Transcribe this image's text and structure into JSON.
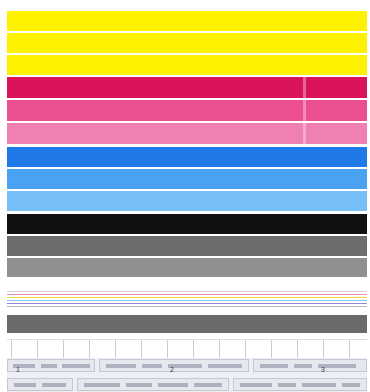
{
  "labels": {
    "marker_1": "1",
    "marker_2": "2",
    "marker_3": "3"
  },
  "colors": {
    "yellow": "#fff200",
    "magenta_dark": "#d9125a",
    "magenta_mid": "#ec4f8f",
    "magenta_light": "#f07fb3",
    "cyan_dark": "#1f7ae7",
    "cyan_mid": "#4aa3f2",
    "cyan_light": "#76bff7",
    "black": "#111111",
    "gray_dark": "#6d6d6d",
    "gray_light": "#8f8f8f",
    "gray_bottom": "#6b6b6b",
    "line_pink": "#ef8db7",
    "line_yellow": "#f4de39",
    "line_cyan": "#7ec7f6",
    "line_violet": "#8f8ad5",
    "line_gray": "#b8b8b8"
  }
}
